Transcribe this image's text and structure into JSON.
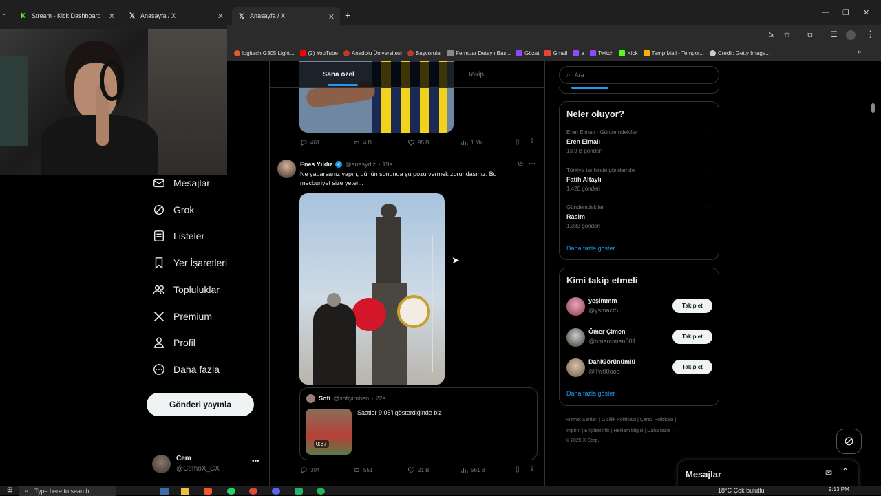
{
  "browser": {
    "tabs": [
      {
        "title": "Stream - Kick Dashboard",
        "icon": "kick-icon",
        "active": false
      },
      {
        "title": "Anasayfa / X",
        "icon": "x-logo-icon",
        "active": false
      },
      {
        "title": "Anasayfa / X",
        "icon": "x-logo-icon",
        "active": true
      }
    ],
    "new_tab": "+",
    "bookmarks": [
      {
        "label": "logitech G305 Light...",
        "color": "#e05a2b"
      },
      {
        "label": "(2) YouTube",
        "color": "#ff0000"
      },
      {
        "label": "Anadolu Üniversitesi",
        "color": "#c0392b"
      },
      {
        "label": "Başvurular",
        "color": "#c0392b"
      },
      {
        "label": "Fermuar Detaylı Bas...",
        "color": "#888888"
      },
      {
        "label": "Gözat",
        "color": "#9146ff"
      },
      {
        "label": "Gmail",
        "color": "#ea4335"
      },
      {
        "label": "a",
        "color": "#9146ff"
      },
      {
        "label": "Twitch",
        "color": "#9146ff"
      },
      {
        "label": "Kick",
        "color": "#53fc18"
      },
      {
        "label": "Temp Mail - Tempor...",
        "color": "#f5b400"
      },
      {
        "label": "Credit: Getty Image...",
        "color": "#cccccc"
      }
    ]
  },
  "nav": {
    "items": [
      "Mesajlar",
      "Grok",
      "Listeler",
      "Yer İşaretleri",
      "Topluluklar",
      "Premium",
      "Profil",
      "Daha fazla"
    ],
    "post_button": "Gönderi yayınla",
    "account": {
      "name": "Cem",
      "handle": "@CemoX_CX"
    }
  },
  "feed": {
    "tabs": [
      "Sana özel",
      "Takip"
    ],
    "prev_stats": {
      "replies": "461",
      "reposts": "4 B",
      "likes": "95 B",
      "views": "1 Mn"
    },
    "tweet": {
      "author": "Enes Yıldız",
      "handle": "@enesydiz",
      "time": "· 19s",
      "text": "Ne yaparsanız yapın, günün sonunda şu pozu vermek zorundasınız. Bu mecburiyet size yeter...",
      "quote": {
        "author": "Sofi",
        "handle": "@sofiyimben",
        "time": "· 22s",
        "text": "Saatler 9.05'i gösterdiğinde biz",
        "duration": "0:37"
      },
      "stats": {
        "replies": "304",
        "reposts": "551",
        "likes": "21 B",
        "views": "561 B"
      }
    }
  },
  "sidebar": {
    "search_placeholder": "Ara",
    "trends_title": "Neler oluyor?",
    "trends": [
      {
        "context": "Eren Elmalı · Gündemdekiler",
        "name": "Eren Elmalı",
        "count": "13,9 B gönderi"
      },
      {
        "context": "Türkiye tarihinde gündemde",
        "name": "Fatih Altaylı",
        "count": "1.420 gönderi"
      },
      {
        "context": "Gündemdekiler",
        "name": "Rasim",
        "count": "1.383 gönderi"
      }
    ],
    "show_more": "Daha fazla göster",
    "who_title": "Kimi takip etmeli",
    "who": [
      {
        "name": "yeşimmm",
        "handle": "@ysmacr5",
        "button": "Takip et"
      },
      {
        "name": "Ömer Çimen",
        "handle": "@omercimen001",
        "button": "Takip et"
      },
      {
        "name": "DahiGörünümlü",
        "handle": "@Tw00ooo",
        "button": "Takip et"
      }
    ],
    "footer_line1": "Hizmet Şartları | Gizlilik Politikası | Çerez Politikası |",
    "footer_line2": "Imprint | Erişilebilirlik | Reklam bilgisi | Daha fazla ···",
    "footer_line3": "© 2025 X Corp."
  },
  "messages_drawer": {
    "title": "Mesajlar"
  },
  "taskbar": {
    "search_placeholder": "Type here to search",
    "weather": "18°C  Çok bulutlu",
    "time": "9:13 PM"
  }
}
